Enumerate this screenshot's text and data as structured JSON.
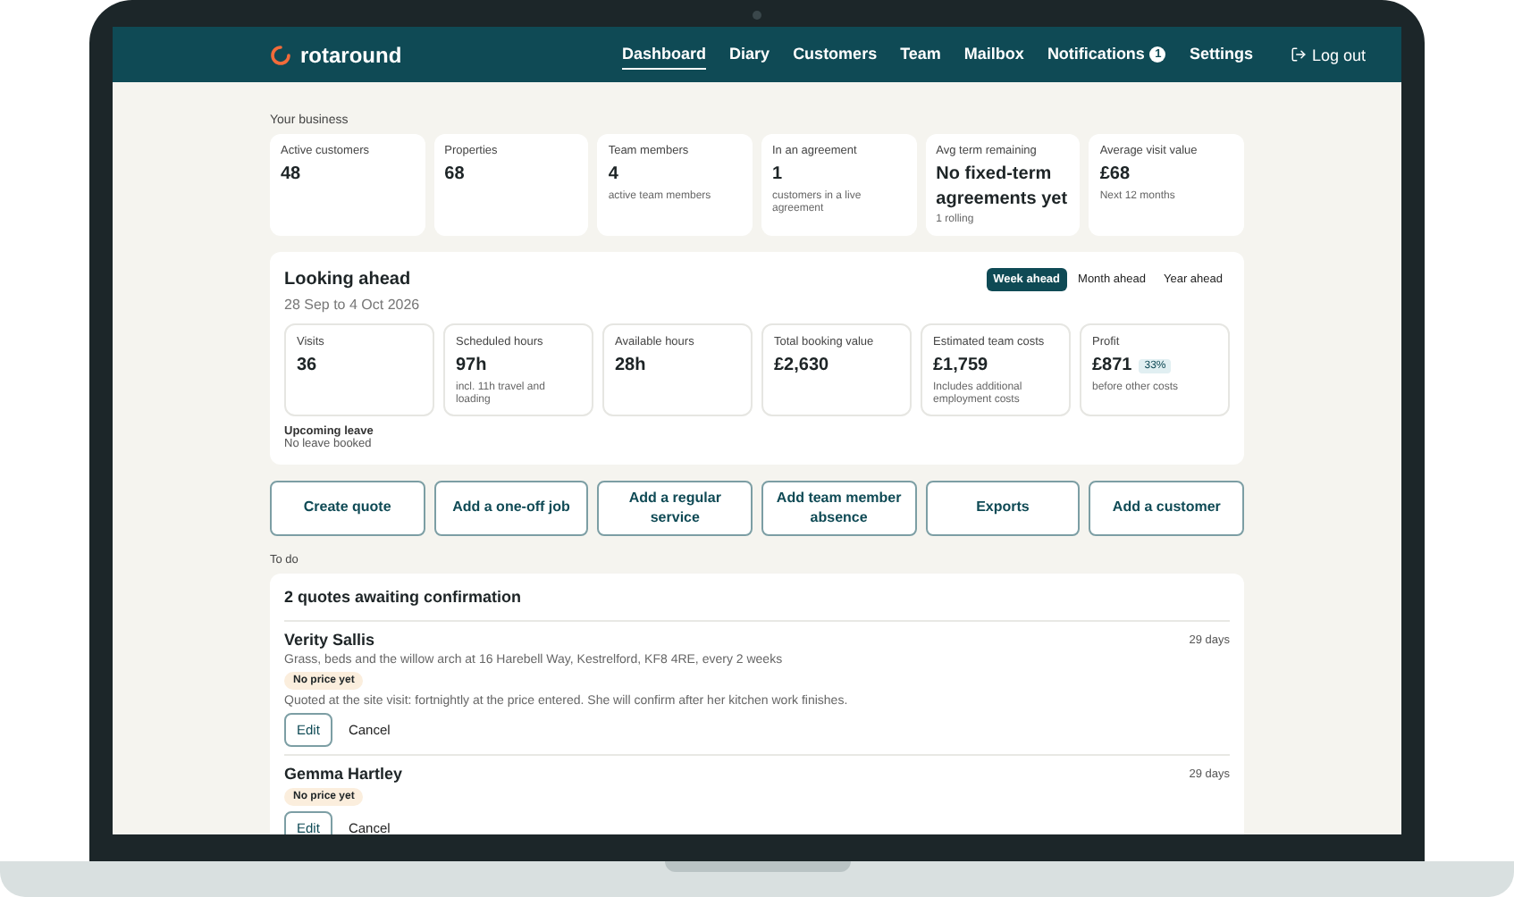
{
  "nav": {
    "brand": "rotaround",
    "items": [
      {
        "label": "Dashboard",
        "selected": true
      },
      {
        "label": "Diary",
        "selected": false
      },
      {
        "label": "Customers",
        "selected": false
      },
      {
        "label": "Team",
        "selected": false
      },
      {
        "label": "Mailbox",
        "selected": false
      },
      {
        "label": "Notifications",
        "selected": false,
        "badge": "1"
      },
      {
        "label": "Settings",
        "selected": false
      }
    ],
    "logout": "Log out"
  },
  "business": {
    "label": "Your business",
    "cards": [
      {
        "label": "Active customers",
        "value": "48"
      },
      {
        "label": "Properties",
        "value": "68"
      },
      {
        "label": "Team members",
        "value": "4",
        "note": "active team members"
      },
      {
        "label": "In an agreement",
        "value": "1",
        "note": "customers in a live agreement"
      },
      {
        "label": "Avg term remaining",
        "value": "No fixed-term agreements yet",
        "note": "1 rolling"
      },
      {
        "label": "Average visit value",
        "value": "£68",
        "note": "Next 12 months"
      }
    ]
  },
  "ahead": {
    "title": "Looking ahead",
    "range": "28 Sep to 4 Oct 2026",
    "periods": [
      {
        "label": "Week ahead",
        "selected": true
      },
      {
        "label": "Month ahead",
        "selected": false
      },
      {
        "label": "Year ahead",
        "selected": false
      }
    ],
    "cards": [
      {
        "label": "Visits",
        "value": "36"
      },
      {
        "label": "Scheduled hours",
        "value": "97h",
        "note": "incl. 11h travel and loading"
      },
      {
        "label": "Available hours",
        "value": "28h"
      },
      {
        "label": "Total booking value",
        "value": "£2,630"
      },
      {
        "label": "Estimated team costs",
        "value": "£1,759",
        "note": "Includes additional employment costs"
      },
      {
        "label": "Profit",
        "value": "£871",
        "badge": "33%",
        "note": "before other costs"
      }
    ],
    "leave": {
      "label": "Upcoming leave",
      "value": "No leave booked"
    }
  },
  "actions": [
    "Create quote",
    "Add a one-off job",
    "Add a regular service",
    "Add team member absence",
    "Exports",
    "Add a customer"
  ],
  "todo": {
    "label": "To do",
    "title": "2 quotes awaiting confirmation",
    "items": [
      {
        "name": "Verity Sallis",
        "age": "29 days",
        "description": "Grass, beds and the willow arch at 16 Harebell Way, Kestrelford, KF8 4RE, every 2 weeks",
        "tag": "No price yet",
        "note": "Quoted at the site visit: fortnightly at the price entered. She will confirm after her kitchen work finishes.",
        "edit": "Edit",
        "cancel": "Cancel"
      },
      {
        "name": "Gemma Hartley",
        "age": "29 days",
        "tag": "No price yet",
        "edit": "Edit",
        "cancel": "Cancel"
      }
    ]
  }
}
